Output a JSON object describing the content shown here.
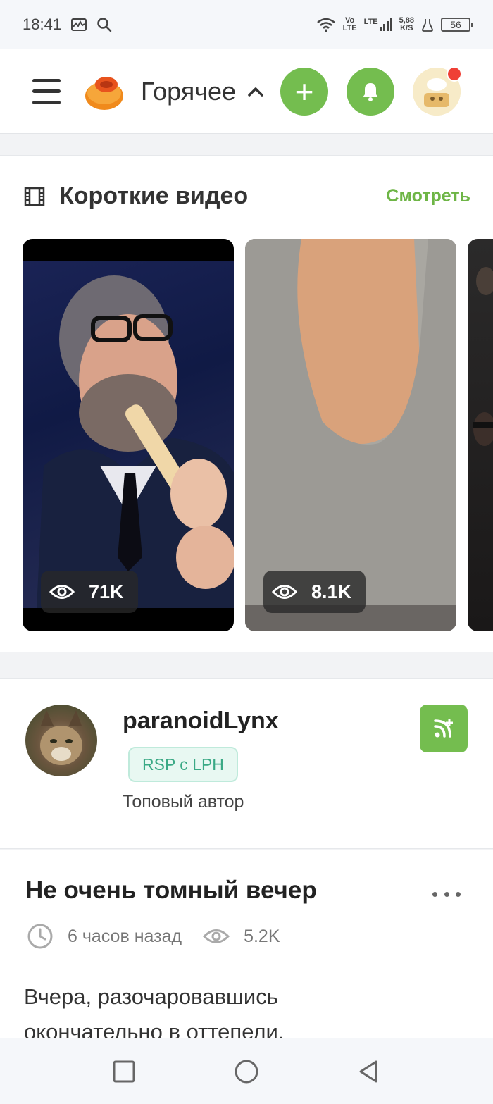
{
  "status_bar": {
    "time": "18:41",
    "network_vo": "Vo",
    "network_lte": "LTE",
    "lte_label": "LTE",
    "speed": "5,88",
    "speed_unit": "K/S",
    "battery": "56"
  },
  "header": {
    "section_title": "Горячее",
    "add_label": "+"
  },
  "short_videos": {
    "title": "Короткие видео",
    "watch_link": "Смотреть",
    "items": [
      {
        "views": "71K"
      },
      {
        "views": "8.1K"
      }
    ]
  },
  "author": {
    "name": "paranoidLynx",
    "badge": "RSP с LPH",
    "rank": "Топовый автор"
  },
  "post": {
    "title": "Не очень томный вечер",
    "time_ago": "6 часов назад",
    "views": "5.2K",
    "text": "Вчера, разочаровавшись окончательно в оттепели,"
  },
  "colors": {
    "accent_green": "#74bd4f",
    "link_green": "#6eb546",
    "badge_green": "#3aa985",
    "notification_red": "#ef4036"
  },
  "icons": [
    "menu-icon",
    "pikabu-logo-icon",
    "chevron-up-icon",
    "plus-icon",
    "bell-icon",
    "film-icon",
    "eye-icon",
    "subscribe-icon",
    "clock-icon",
    "more-icon",
    "square-nav-icon",
    "circle-nav-icon",
    "triangle-back-icon"
  ]
}
